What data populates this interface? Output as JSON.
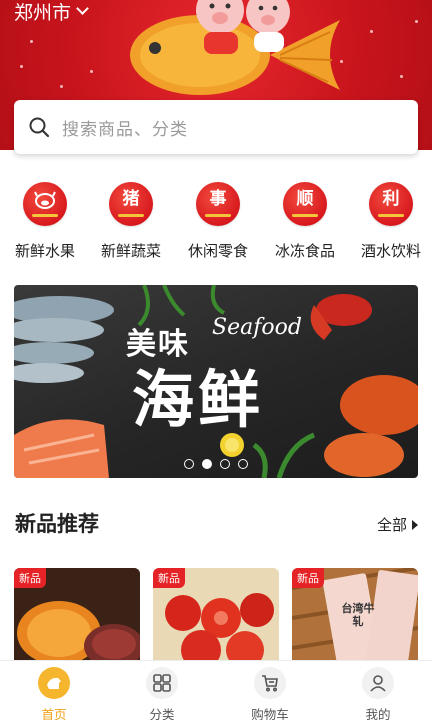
{
  "header": {
    "city": "郑州市"
  },
  "search": {
    "placeholder": "搜索商品、分类"
  },
  "categories": [
    {
      "badge": "",
      "label": "新鲜水果"
    },
    {
      "badge": "猪",
      "label": "新鲜蔬菜"
    },
    {
      "badge": "事",
      "label": "休闲零食"
    },
    {
      "badge": "顺",
      "label": "冰冻食品"
    },
    {
      "badge": "利",
      "label": "酒水饮料"
    }
  ],
  "carousel": {
    "title": "美味",
    "title_en": "Seafood",
    "big_text": "海鲜",
    "dots_total": 4,
    "active_dot": 1
  },
  "section": {
    "title": "新品推荐",
    "more": "全部"
  },
  "products": [
    {
      "tag": "新品"
    },
    {
      "tag": "新品"
    },
    {
      "tag": "新品",
      "pack_text": "台湾牛轧"
    }
  ],
  "tabbar": [
    {
      "label": "首页",
      "icon": "home-icon",
      "active": true
    },
    {
      "label": "分类",
      "icon": "category-grid-icon",
      "active": false
    },
    {
      "label": "购物车",
      "icon": "cart-icon",
      "active": false
    },
    {
      "label": "我的",
      "icon": "user-icon",
      "active": false
    }
  ],
  "colors": {
    "brand_red": "#d8191e",
    "accent_gold": "#f5b52d",
    "tab_active_text": "#f0a21c"
  }
}
